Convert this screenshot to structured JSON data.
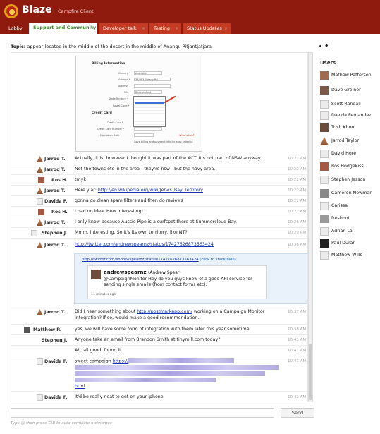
{
  "app": {
    "title": "Blaze",
    "subtitle": "Campfire Client"
  },
  "tabs": [
    {
      "label": "Lobby",
      "active": false,
      "closable": false
    },
    {
      "label": "Support and Community",
      "active": true,
      "closable": true
    },
    {
      "label": "Developer talk",
      "active": false,
      "closable": true
    },
    {
      "label": "Testing",
      "active": false,
      "closable": true
    },
    {
      "label": "Status Updates",
      "active": false,
      "closable": true
    }
  ],
  "topic": {
    "label": "Topic:",
    "text": "appear located in the middle of the desert in the middle of Anangu Pitjantjatjara"
  },
  "topic_icons": [
    "speaker-icon",
    "pin-icon"
  ],
  "embedded_form": {
    "billing_heading": "Billing Information",
    "country_label": "Country *",
    "country_value": "Australia",
    "address_label": "Address *",
    "address_value": "33/383 Botany Rd",
    "address2_label": "Address",
    "city_label": "City *",
    "city_value": "Beaconsfield",
    "state_label": "State/Territory *",
    "state_options": [
      "Select a Territory",
      "Australian Capital Territory",
      "Jervis Bay Territory",
      "New South Wales",
      "Northern Territory",
      "Queensland",
      "South Australia",
      "Tasmania",
      "Victoria",
      "Western Australia"
    ],
    "postal_label": "Postal Code *",
    "credit_heading": "Credit Card",
    "card_label": "Credit Card *",
    "card_number_label": "Credit Card Number *",
    "expiry_label": "Expiration Date *",
    "whats_this": "What's this?",
    "save_text": "Save billing and payment info for easy ordering"
  },
  "messages": [
    {
      "author": "Jarrod T.",
      "avatar": "cone",
      "text": "Actually, it is, however I thought it was part of the ACT. It's not part of NSW anyway.",
      "time": "10:21 AM"
    },
    {
      "author": "Jarrod T.",
      "avatar": "cone",
      "text": "Not the towns etc in the area - they're nsw - but the navy area.",
      "time": "10:22 AM"
    },
    {
      "author": "Ros H.",
      "avatar": "photo1",
      "text": "tmyk",
      "time": "10:22 AM"
    },
    {
      "author": "Jarrod T.",
      "avatar": "cone",
      "text_prefix": "Here y'ar: ",
      "link": "http://en.wikipedia.org/wiki/Jervis_Bay_Territory",
      "time": "10:22 AM"
    },
    {
      "author": "Davida F.",
      "avatar": "blank",
      "text": "gonna go clean spam filters and then do reviews",
      "time": "10:22 AM"
    },
    {
      "author": "Ros H.",
      "avatar": "photo1",
      "text": "I had no idea. How interesting!",
      "time": "10:22 AM"
    },
    {
      "author": "Jarrod T.",
      "avatar": "cone",
      "text": "I only know because Aussie Pipe is a surfspot there at Summercloud Bay.",
      "time": "10:26 AM"
    },
    {
      "author": "Stephen J.",
      "avatar": "blank",
      "text": "Mmm, interesting. So it's its own territory, like NT?",
      "time": "10:29 AM"
    },
    {
      "author": "Jarrod T.",
      "avatar": "cone",
      "link": "http://twitter.com/andrewspearnz/status/17427626873563424",
      "time": "10:36 AM"
    },
    {
      "author": "Jarrod T.",
      "avatar": "cone",
      "text_prefix": "Did I hear something about ",
      "link": "http://postmarkapp.com/",
      "text_suffix": " working on a Campaign Monitor integration? If so, would make a good recommendation.",
      "time": "10:37 AM"
    },
    {
      "author": "Matthew P.",
      "avatar": "photo2",
      "text": "yes, we will have some form of integration with them later this year sometime",
      "time": "10:38 AM"
    },
    {
      "author": "Stephen J.",
      "avatar": "blank",
      "text": "Anyone take an email from Brandon Smith at tinymill.com today?",
      "time": "10:41 AM"
    },
    {
      "author": "",
      "avatar": "",
      "text": "Ah, all good, found it",
      "time": "10:41 AM"
    },
    {
      "author": "Davida F.",
      "avatar": "blank",
      "text_prefix": "sweet campaign ",
      "link": "https://",
      "link_end": "html",
      "time": "10:41 AM"
    },
    {
      "author": "Davida F.",
      "avatar": "blank",
      "text": "It'd be really neat to get on your iphone",
      "time": "10:42 AM"
    }
  ],
  "tweet": {
    "embed_link": "http://twitter.com/andrewspearnz/status/17427626873563424",
    "toggle": "(click to show/hide)",
    "handle": "andrewspearnz",
    "full_name": "(Andrew Spear)",
    "text": "@CampaignMonitor Hey do you guys know of a good API service for sending single emails (from contact forms etc).",
    "time": "11 minutes ago"
  },
  "input": {
    "placeholder": "",
    "hint": "Type @ then press TAB to auto-complete nicknames"
  },
  "send_label": "Send",
  "users": {
    "title": "Users",
    "list": [
      {
        "name": "Mathew Patterson",
        "avatar": "photo"
      },
      {
        "name": "Dave Greiner",
        "avatar": "photo"
      },
      {
        "name": "Scott Randall",
        "avatar": "blank"
      },
      {
        "name": "Davida Fernandez",
        "avatar": "blank"
      },
      {
        "name": "Trish Khoo",
        "avatar": "photo"
      },
      {
        "name": "Jarrod Taylor",
        "avatar": "cone"
      },
      {
        "name": "David Hore",
        "avatar": "blank"
      },
      {
        "name": "Ros Hodgekiss",
        "avatar": "photo"
      },
      {
        "name": "Stephen Jesson",
        "avatar": "blank"
      },
      {
        "name": "Cameron Newman",
        "avatar": "photo"
      },
      {
        "name": "Carissa",
        "avatar": "blank"
      },
      {
        "name": "freshbot",
        "avatar": "photo"
      },
      {
        "name": "Adrian Lai",
        "avatar": "blank"
      },
      {
        "name": "Paul Duran",
        "avatar": "photo"
      },
      {
        "name": "Matthew Wills",
        "avatar": "blank"
      }
    ]
  },
  "colors": {
    "header": "#8f1a0e",
    "tab": "#c43a22",
    "active_tab_text": "#3b8c2a",
    "link": "#1a33b0"
  }
}
